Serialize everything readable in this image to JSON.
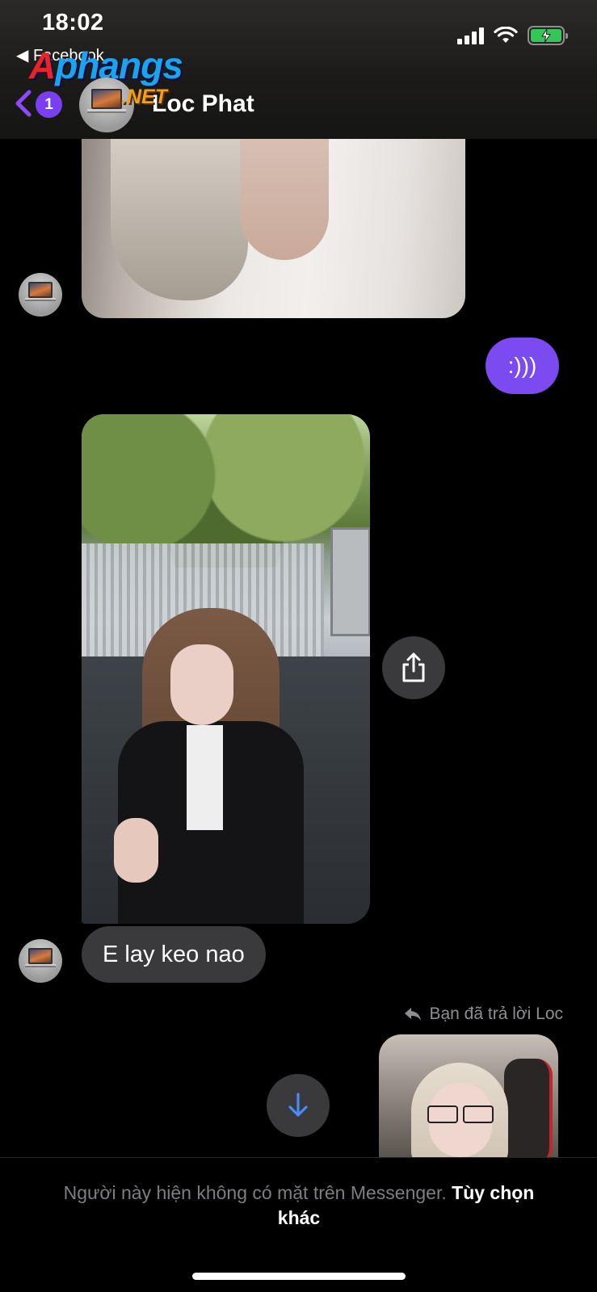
{
  "status_bar": {
    "time": "18:02",
    "back_app": "Facebook",
    "battery_state": "charging",
    "battery_color": "#33c759"
  },
  "watermark": {
    "part1": "A",
    "part2": "phangs",
    "suffix": ".NET"
  },
  "header": {
    "back_icon": "chevron-left-icon",
    "unread_count": "1",
    "contact_name": "Loc Phat",
    "accent_color": "#7a3ff2"
  },
  "messages": [
    {
      "type": "image",
      "direction": "incoming",
      "description_icon": "photo"
    },
    {
      "type": "text",
      "direction": "outgoing",
      "text": ":)))"
    },
    {
      "type": "image",
      "direction": "incoming",
      "description_icon": "photo"
    },
    {
      "type": "text",
      "direction": "incoming",
      "text": "E lay keo nao"
    },
    {
      "type": "reply_image",
      "direction": "outgoing",
      "reply_note": "Bạn đã trả lời Loc"
    }
  ],
  "controls": {
    "share_icon": "share-icon",
    "scroll_down_icon": "arrow-down-icon"
  },
  "footer": {
    "notice": "Người này hiện không có mặt trên Messenger.",
    "action_link": "Tùy chọn khác"
  },
  "colors": {
    "outgoing_bubble": "#7b4af0",
    "incoming_bubble": "#3a3a3c",
    "scroll_arrow": "#4a8bf5"
  }
}
